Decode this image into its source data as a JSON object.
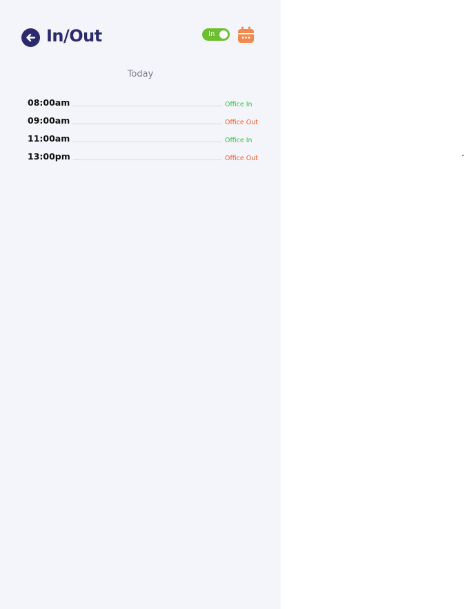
{
  "header": {
    "title": "In/Out",
    "back_icon": "arrow-left-circle-icon",
    "toggle": {
      "label": "In",
      "state": "on",
      "color": "#6cbf2e"
    },
    "calendar_icon": "calendar-icon"
  },
  "section": {
    "label": "Today"
  },
  "log": [
    {
      "time": "08:00am",
      "status": "Office In",
      "type": "in"
    },
    {
      "time": "09:00am",
      "status": "Office Out",
      "type": "out"
    },
    {
      "time": "11:00am",
      "status": "Office In",
      "type": "in"
    },
    {
      "time": "13:00pm",
      "status": "Office Out",
      "type": "out"
    }
  ],
  "colors": {
    "brand": "#2b2a6e",
    "accent": "#f28a4e",
    "in": "#2fbf3e",
    "out": "#f0582a",
    "panel_bg": "#f4f5fa"
  }
}
